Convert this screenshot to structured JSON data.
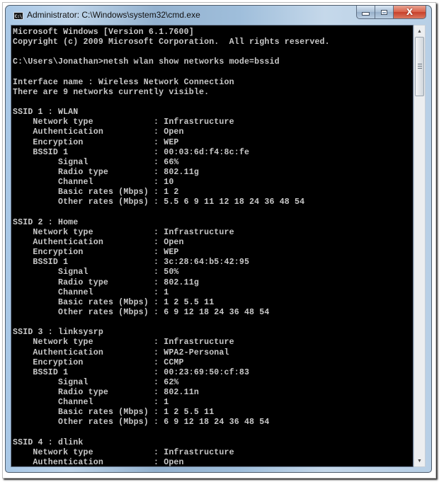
{
  "window": {
    "title": "Administrator: C:\\Windows\\system32\\cmd.exe",
    "icon_label": "C:\\",
    "buttons": {
      "minimize": "minimize",
      "maximize": "maximize",
      "close": "X"
    }
  },
  "scrollbar": {
    "up_arrow": "▲",
    "down_arrow": "▼"
  },
  "console": {
    "lines": [
      "Microsoft Windows [Version 6.1.7600]",
      "Copyright (c) 2009 Microsoft Corporation.  All rights reserved.",
      "",
      "C:\\Users\\Jonathan>netsh wlan show networks mode=bssid",
      "",
      "Interface name : Wireless Network Connection",
      "There are 9 networks currently visible.",
      "",
      "SSID 1 : WLAN",
      "    Network type            : Infrastructure",
      "    Authentication          : Open",
      "    Encryption              : WEP",
      "    BSSID 1                 : 00:03:6d:f4:8c:fe",
      "         Signal             : 66%",
      "         Radio type         : 802.11g",
      "         Channel            : 10",
      "         Basic rates (Mbps) : 1 2",
      "         Other rates (Mbps) : 5.5 6 9 11 12 18 24 36 48 54",
      "",
      "SSID 2 : Home",
      "    Network type            : Infrastructure",
      "    Authentication          : Open",
      "    Encryption              : WEP",
      "    BSSID 1                 : 3c:28:64:b5:42:95",
      "         Signal             : 50%",
      "         Radio type         : 802.11g",
      "         Channel            : 1",
      "         Basic rates (Mbps) : 1 2 5.5 11",
      "         Other rates (Mbps) : 6 9 12 18 24 36 48 54",
      "",
      "SSID 3 : linksysrp",
      "    Network type            : Infrastructure",
      "    Authentication          : WPA2-Personal",
      "    Encryption              : CCMP",
      "    BSSID 1                 : 00:23:69:50:cf:83",
      "         Signal             : 62%",
      "         Radio type         : 802.11n",
      "         Channel            : 1",
      "         Basic rates (Mbps) : 1 2 5.5 11",
      "         Other rates (Mbps) : 6 9 12 18 24 36 48 54",
      "",
      "SSID 4 : dlink",
      "    Network type            : Infrastructure",
      "    Authentication          : Open"
    ]
  },
  "colors": {
    "console_bg": "#000000",
    "console_fg": "#c8c8c8",
    "close_button": "#c7402a"
  }
}
